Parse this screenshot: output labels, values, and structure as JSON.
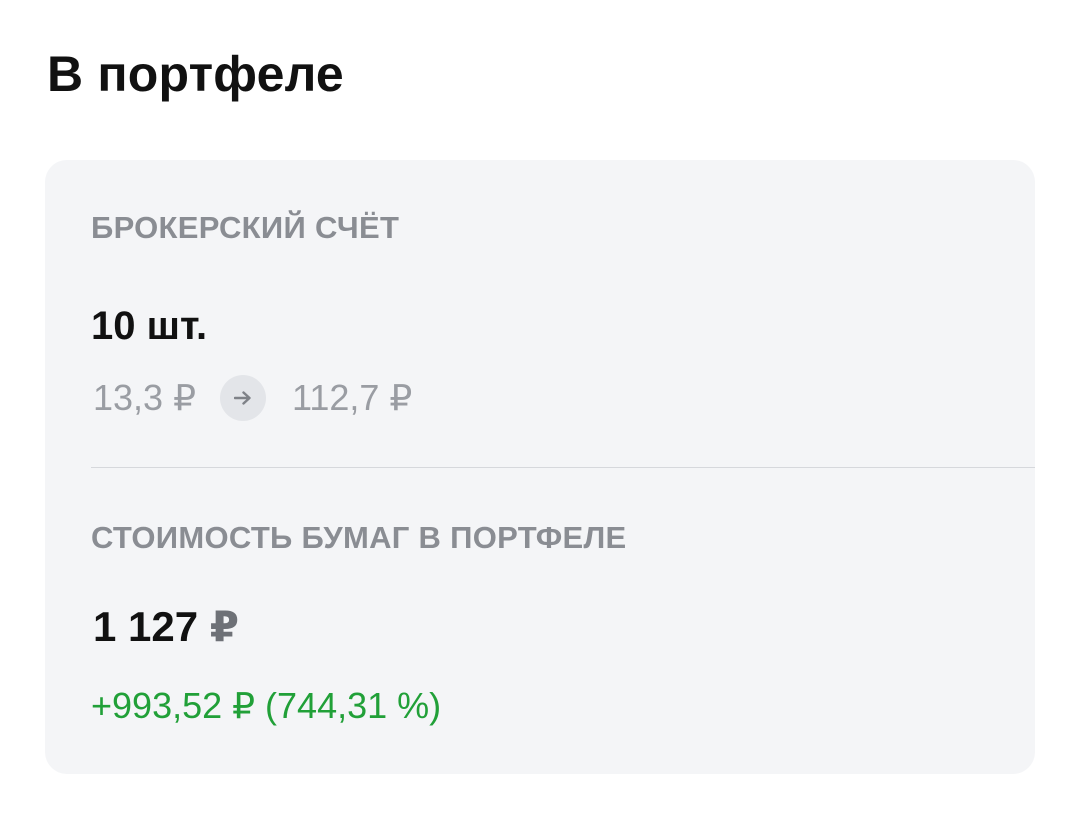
{
  "header": {
    "title": "В портфеле"
  },
  "card": {
    "account_label": "БРОКЕРСКИЙ СЧЁТ",
    "quantity": "10 шт.",
    "price_from": "13,3 ₽",
    "price_to": "112,7 ₽",
    "value_label": "СТОИМОСТЬ БУМАГ В ПОРТФЕЛЕ",
    "total_amount": "1 127",
    "total_currency": "₽",
    "change": "+993,52 ₽ (744,31 %)"
  },
  "icons": {
    "arrow": "arrow-right-icon"
  },
  "colors": {
    "positive_change": "#21a038",
    "card_background": "#f4f5f7"
  }
}
